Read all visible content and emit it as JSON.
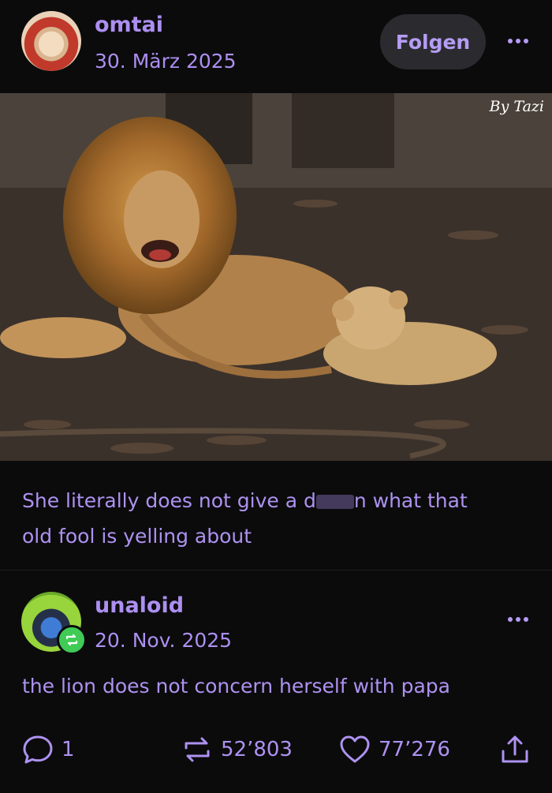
{
  "post": {
    "author": "omtai",
    "date": "30. März 2025",
    "follow_label": "Folgen",
    "image_signature": "By Tazi",
    "caption_before": "She literally does not give a d",
    "caption_after": "n what that",
    "caption_line2": "old fool is yelling about"
  },
  "reblog": {
    "author": "unaloid",
    "date": "20. Nov. 2025",
    "text": "the lion does not concern herself with papa"
  },
  "actions": {
    "comments": "1",
    "reblogs": "52’803",
    "likes": "77’276"
  },
  "colors": {
    "accent": "#ae92f0",
    "background": "#0b0b0c",
    "reblog_badge": "#3fcb55"
  }
}
